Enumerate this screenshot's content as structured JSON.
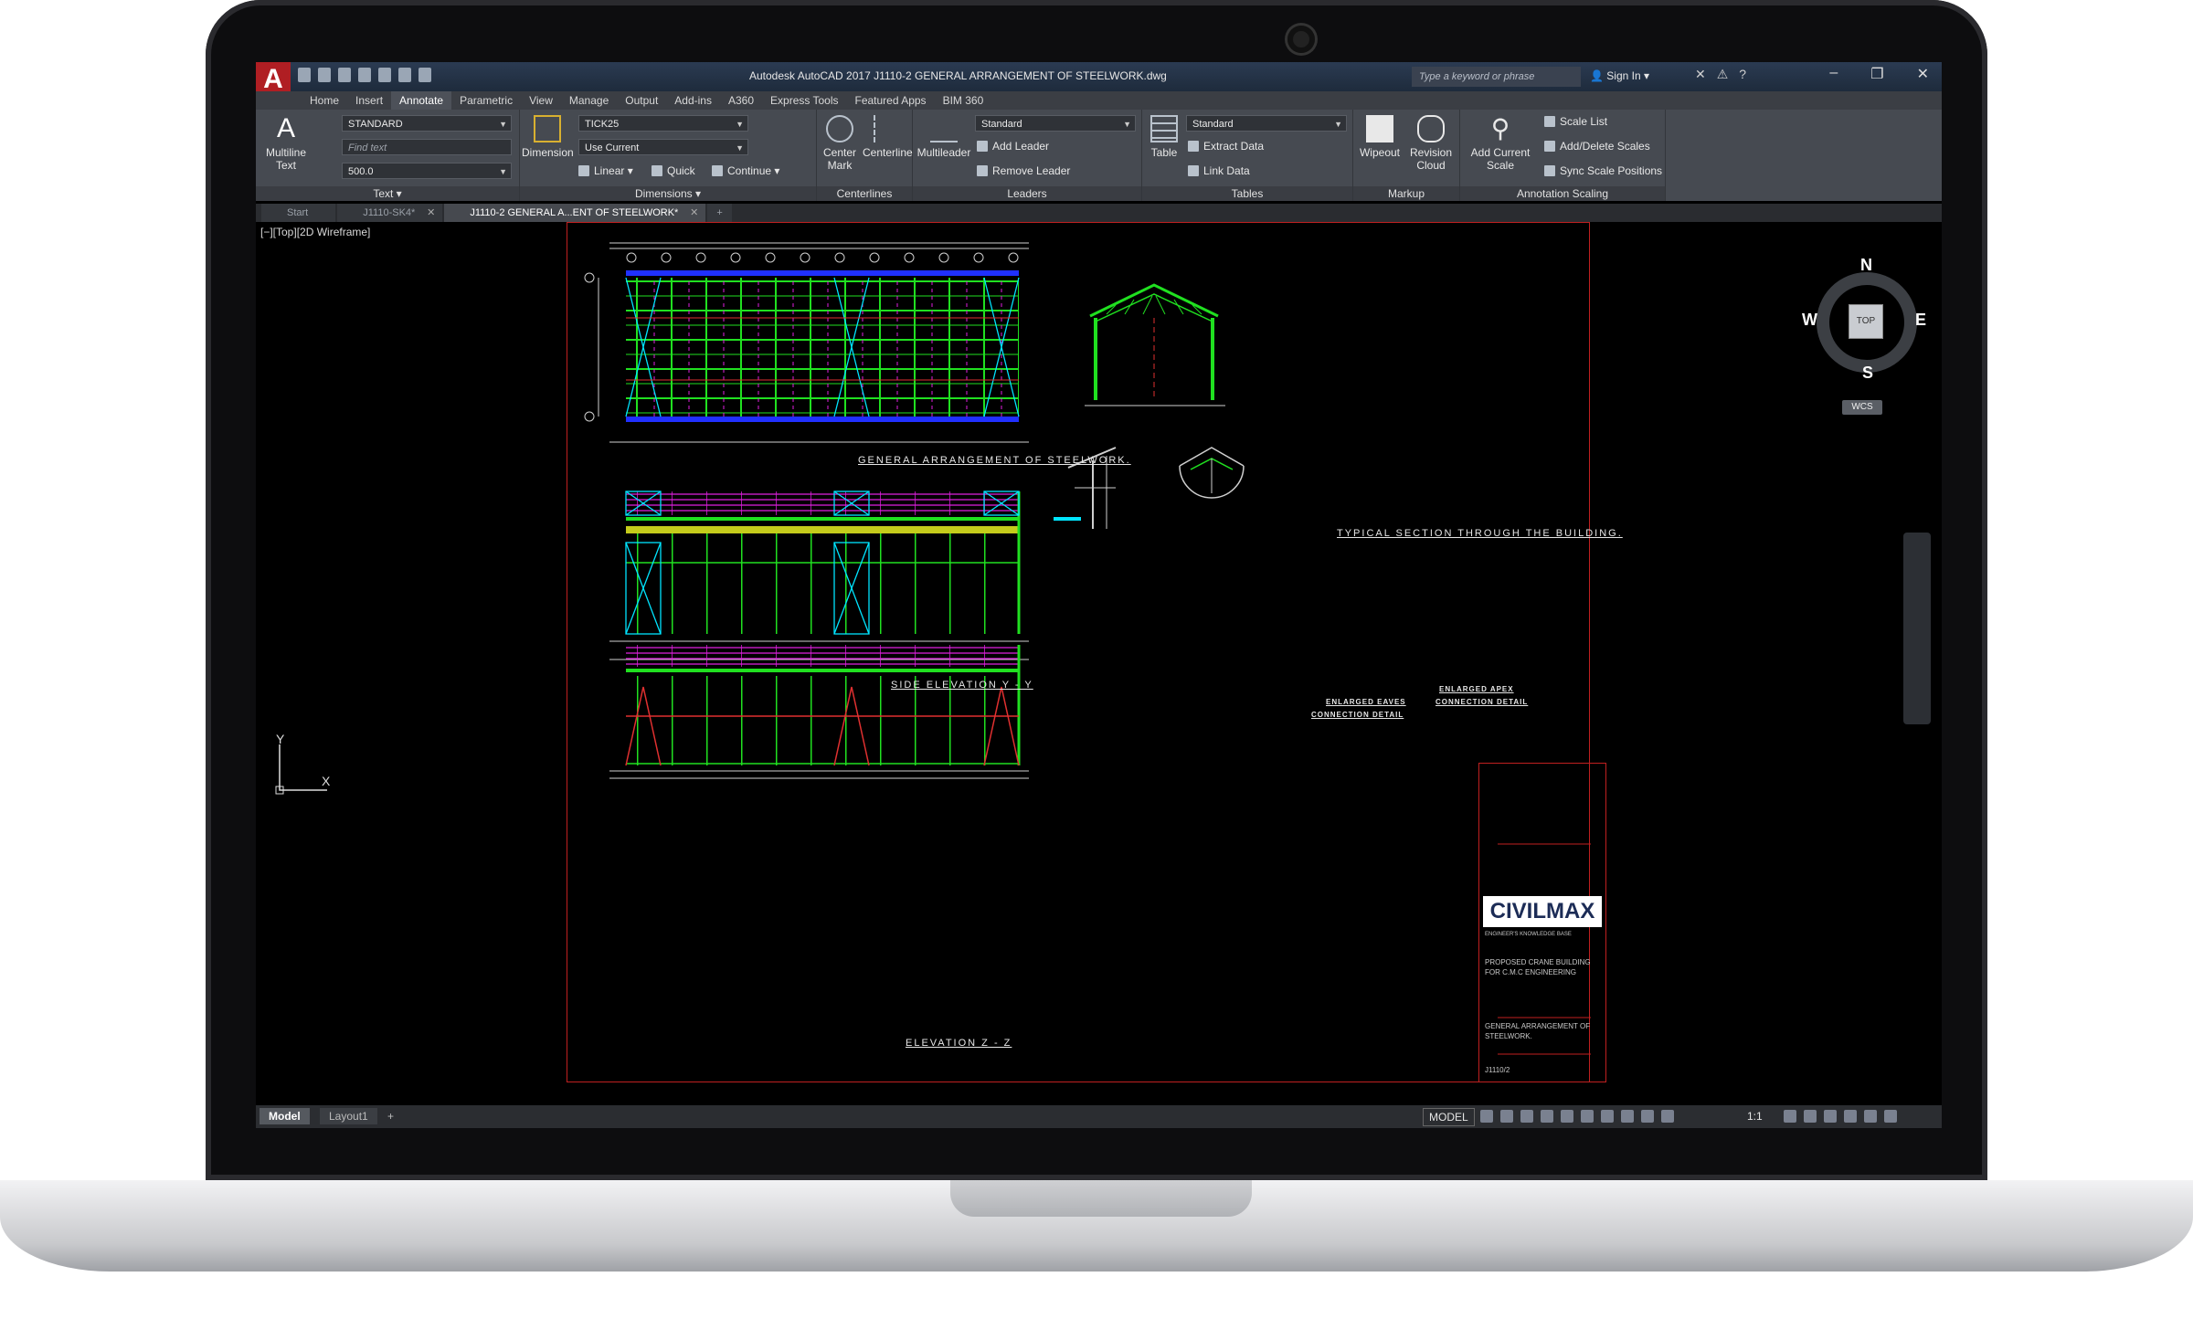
{
  "app": {
    "title": "Autodesk AutoCAD 2017   J1110-2 GENERAL ARRANGEMENT OF STEELWORK.dwg",
    "logo_letter": "A",
    "search_placeholder": "Type a keyword or phrase",
    "signin_label": "Sign In"
  },
  "ribbon_tabs": [
    "Home",
    "Insert",
    "Annotate",
    "Parametric",
    "View",
    "Manage",
    "Output",
    "Add-ins",
    "A360",
    "Express Tools",
    "Featured Apps",
    "BIM 360"
  ],
  "ribbon": {
    "text": {
      "multiline_text": "Multiline Text",
      "style_value": "STANDARD",
      "find_placeholder": "Find text",
      "height_value": "500.0",
      "panel_title": "Text ▾"
    },
    "dimensions": {
      "dimension": "Dimension",
      "style_value": "TICK25",
      "layer_value": "Use Current",
      "linear": "Linear",
      "quick": "Quick",
      "continue": "Continue",
      "panel_title": "Dimensions ▾"
    },
    "centerlines": {
      "center_mark": "Center Mark",
      "centerline": "Centerline",
      "panel_title": "Centerlines"
    },
    "leaders": {
      "multileader": "Multileader",
      "style_value": "Standard",
      "add_leader": "Add Leader",
      "remove_leader": "Remove Leader",
      "panel_title": "Leaders"
    },
    "tables": {
      "table": "Table",
      "style_value": "Standard",
      "extract_data": "Extract Data",
      "link_data": "Link Data",
      "panel_title": "Tables"
    },
    "markup": {
      "wipeout": "Wipeout",
      "revision_cloud": "Revision Cloud",
      "panel_title": "Markup"
    },
    "annotation_scaling": {
      "add_current_scale": "Add Current Scale",
      "scale_list": "Scale List",
      "add_delete_scales": "Add/Delete Scales",
      "sync_scale_positions": "Sync Scale Positions",
      "panel_title": "Annotation Scaling"
    }
  },
  "file_tabs": [
    "Start",
    "J1110-SK4*",
    "J1110-2 GENERAL A...ENT OF STEELWORK*"
  ],
  "file_tab_plus": "+",
  "viewport_label": "[−][Top][2D Wireframe]",
  "drawing": {
    "plan_title": "GENERAL  ARRANGEMENT  OF  STEELWORK.",
    "section_title": "TYPICAL  SECTION  THROUGH  THE  BUILDING.",
    "side_elevation_title": "SIDE  ELEVATION  Y - Y",
    "elevation_title": "ELEVATION  Z - Z",
    "eaves_detail_1": "ENLARGED EAVES",
    "eaves_detail_2": "CONNECTION DETAIL",
    "apex_detail_1": "ENLARGED APEX",
    "apex_detail_2": "CONNECTION DETAIL"
  },
  "title_block": {
    "logo": "CIVILMAX",
    "logo_tagline": "ENGINEER'S KNOWLEDGE BASE",
    "project": "PROPOSED CRANE BUILDING\nFOR C.M.C ENGINEERING",
    "drawing_title": "GENERAL  ARRANGEMENT OF\nSTEELWORK.",
    "drawing_number": "J1110/2"
  },
  "viewcube": {
    "north": "N",
    "south": "S",
    "east": "E",
    "west": "W",
    "face": "TOP",
    "wcs": "WCS"
  },
  "ucs": {
    "x": "X",
    "y": "Y"
  },
  "status_bar": {
    "layout_tabs": [
      "Model",
      "Layout1"
    ],
    "layout_plus": "+",
    "model_button": "MODEL",
    "annotation_scale": "1:1"
  },
  "colors": {
    "accent_red": "#b01e23",
    "structure_green": "#20e020",
    "bracing_cyan": "#00e5ff",
    "purlin_magenta": "#e020e0",
    "border_red": "#c02020",
    "blue_member": "#2030ff"
  }
}
